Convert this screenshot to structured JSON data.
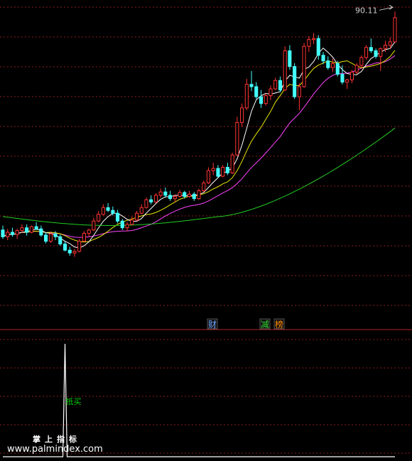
{
  "chart_data": [
    {
      "type": "candlestick",
      "panel": "price",
      "peak_label": "90.11",
      "ylim": [
        40,
        92
      ],
      "ma_colors": {
        "ma5": "#ffffff",
        "ma10": "#e8e800",
        "ma20": "#ff44ff",
        "ma60": "#22cc22"
      },
      "up_color": "#ff3333",
      "down_color": "#44ffff",
      "candles": [
        [
          52.2,
          53.0,
          50.6,
          51.0
        ],
        [
          51.0,
          52.4,
          50.4,
          51.8
        ],
        [
          51.8,
          52.6,
          51.0,
          51.4
        ],
        [
          51.4,
          52.4,
          50.6,
          52.1
        ],
        [
          52.1,
          53.2,
          51.7,
          52.6
        ],
        [
          52.6,
          53.2,
          51.2,
          51.8
        ],
        [
          51.8,
          53.0,
          51.6,
          52.8
        ],
        [
          52.8,
          53.6,
          52.2,
          52.4
        ],
        [
          52.4,
          53.0,
          51.0,
          51.3
        ],
        [
          51.3,
          51.8,
          49.8,
          50.2
        ],
        [
          50.2,
          51.8,
          49.9,
          51.5
        ],
        [
          51.5,
          52.0,
          50.4,
          51.0
        ],
        [
          51.0,
          51.4,
          49.4,
          49.7
        ],
        [
          49.7,
          50.2,
          48.4,
          48.6
        ],
        [
          48.6,
          49.2,
          47.6,
          48.1
        ],
        [
          48.1,
          48.8,
          47.4,
          48.4
        ],
        [
          48.4,
          50.6,
          48.2,
          50.2
        ],
        [
          50.2,
          52.0,
          50.0,
          51.6
        ],
        [
          51.6,
          52.4,
          51.0,
          52.2
        ],
        [
          52.2,
          54.4,
          52.0,
          53.8
        ],
        [
          53.8,
          55.6,
          53.6,
          55.0
        ],
        [
          55.0,
          56.8,
          54.8,
          56.2
        ],
        [
          56.2,
          57.0,
          55.4,
          55.7
        ],
        [
          55.7,
          56.4,
          54.8,
          55.2
        ],
        [
          55.2,
          55.8,
          53.4,
          53.8
        ],
        [
          53.8,
          54.2,
          52.2,
          52.6
        ],
        [
          52.6,
          53.6,
          52.0,
          53.2
        ],
        [
          53.2,
          54.6,
          53.0,
          54.0
        ],
        [
          54.0,
          55.6,
          53.8,
          55.2
        ],
        [
          55.2,
          56.8,
          55.0,
          56.2
        ],
        [
          56.2,
          58.0,
          56.0,
          57.6
        ],
        [
          57.6,
          58.4,
          56.8,
          57.2
        ],
        [
          57.2,
          58.8,
          57.0,
          58.4
        ],
        [
          58.4,
          59.6,
          58.0,
          59.0
        ],
        [
          59.0,
          59.8,
          58.0,
          58.4
        ],
        [
          58.4,
          59.2,
          57.4,
          57.8
        ],
        [
          57.8,
          58.6,
          57.2,
          58.2
        ],
        [
          58.2,
          59.4,
          58.0,
          58.9
        ],
        [
          58.9,
          59.2,
          57.8,
          58.2
        ],
        [
          58.2,
          59.2,
          58.0,
          58.6
        ],
        [
          58.6,
          59.0,
          57.4,
          57.8
        ],
        [
          57.8,
          59.6,
          57.6,
          59.2
        ],
        [
          59.2,
          61.0,
          59.0,
          60.6
        ],
        [
          60.6,
          63.4,
          60.4,
          62.8
        ],
        [
          62.8,
          64.2,
          62.0,
          63.2
        ],
        [
          63.2,
          63.8,
          61.6,
          61.8
        ],
        [
          61.8,
          63.8,
          61.6,
          63.4
        ],
        [
          63.4,
          64.2,
          62.0,
          62.4
        ],
        [
          62.4,
          66.0,
          62.2,
          65.6
        ],
        [
          65.6,
          72.4,
          65.4,
          71.4
        ],
        [
          71.4,
          74.8,
          70.6,
          74.0
        ],
        [
          74.0,
          79.2,
          73.6,
          78.2
        ],
        [
          78.2,
          80.6,
          77.0,
          77.8
        ],
        [
          77.8,
          78.6,
          75.6,
          76.0
        ],
        [
          76.0,
          77.2,
          74.0,
          74.8
        ],
        [
          74.8,
          76.6,
          74.4,
          76.2
        ],
        [
          76.2,
          78.0,
          75.4,
          77.4
        ],
        [
          77.4,
          79.4,
          77.2,
          78.9
        ],
        [
          78.9,
          79.6,
          76.8,
          77.2
        ],
        [
          77.2,
          85.0,
          77.0,
          84.2
        ],
        [
          84.2,
          85.2,
          80.8,
          81.4
        ],
        [
          81.4,
          82.0,
          75.6,
          76.0
        ],
        [
          76.0,
          78.4,
          73.6,
          77.8
        ],
        [
          77.8,
          85.6,
          77.6,
          85.0
        ],
        [
          85.0,
          86.8,
          84.0,
          86.2
        ],
        [
          86.2,
          87.4,
          85.4,
          86.4
        ],
        [
          86.4,
          87.0,
          82.6,
          83.4
        ],
        [
          83.4,
          84.0,
          81.8,
          82.4
        ],
        [
          82.4,
          83.2,
          80.8,
          81.2
        ],
        [
          81.2,
          82.8,
          80.4,
          81.9
        ],
        [
          81.9,
          82.4,
          79.6,
          80.0
        ],
        [
          80.0,
          81.6,
          78.2,
          78.6
        ],
        [
          78.6,
          79.2,
          77.4,
          79.0
        ],
        [
          79.0,
          80.8,
          78.4,
          80.4
        ],
        [
          80.4,
          82.0,
          80.0,
          81.6
        ],
        [
          81.6,
          83.4,
          81.2,
          83.0
        ],
        [
          83.0,
          85.2,
          82.6,
          84.8
        ],
        [
          84.8,
          86.4,
          83.8,
          84.2
        ],
        [
          84.2,
          84.6,
          82.8,
          83.2
        ],
        [
          83.2,
          84.8,
          80.6,
          84.6
        ],
        [
          84.6,
          86.0,
          84.0,
          85.2
        ],
        [
          85.2,
          86.6,
          84.6,
          85.8
        ],
        [
          85.8,
          91.2,
          85.6,
          90.11
        ]
      ],
      "ma60_end": [
        70.4,
        58.4
      ]
    },
    {
      "type": "line",
      "panel": "indicator",
      "series_color": "#ffffff",
      "signal_label": "抵买",
      "signal_color": "#00cc00",
      "signal_index": 13,
      "ylim": [
        0,
        1
      ],
      "values": [
        0,
        0,
        0,
        0,
        0,
        0,
        0,
        0,
        0,
        0,
        0,
        0,
        0,
        1,
        0,
        0,
        0,
        0,
        0,
        0,
        0,
        0,
        0,
        0,
        0,
        0,
        0,
        0,
        0,
        0,
        0,
        0,
        0,
        0,
        0,
        0,
        0,
        0,
        0,
        0,
        0,
        0,
        0,
        0,
        0,
        0,
        0,
        0,
        0,
        0,
        0,
        0,
        0,
        0,
        0,
        0,
        0,
        0,
        0,
        0,
        0,
        0,
        0,
        0,
        0,
        0,
        0,
        0,
        0,
        0,
        0,
        0,
        0,
        0,
        0,
        0,
        0,
        0,
        0,
        0,
        0,
        0,
        0
      ]
    }
  ],
  "badges": [
    {
      "text": "财",
      "color": "#6fa8ff"
    },
    {
      "text": "减",
      "color": "#33dd33"
    },
    {
      "text": "榜",
      "color": "#ff8800"
    }
  ],
  "watermark": {
    "line1": "掌上指标",
    "line2": "www.palmindex.com"
  },
  "colors": {
    "grid": "#8b1c1c",
    "divider": "#b02020",
    "background": "#000000"
  }
}
